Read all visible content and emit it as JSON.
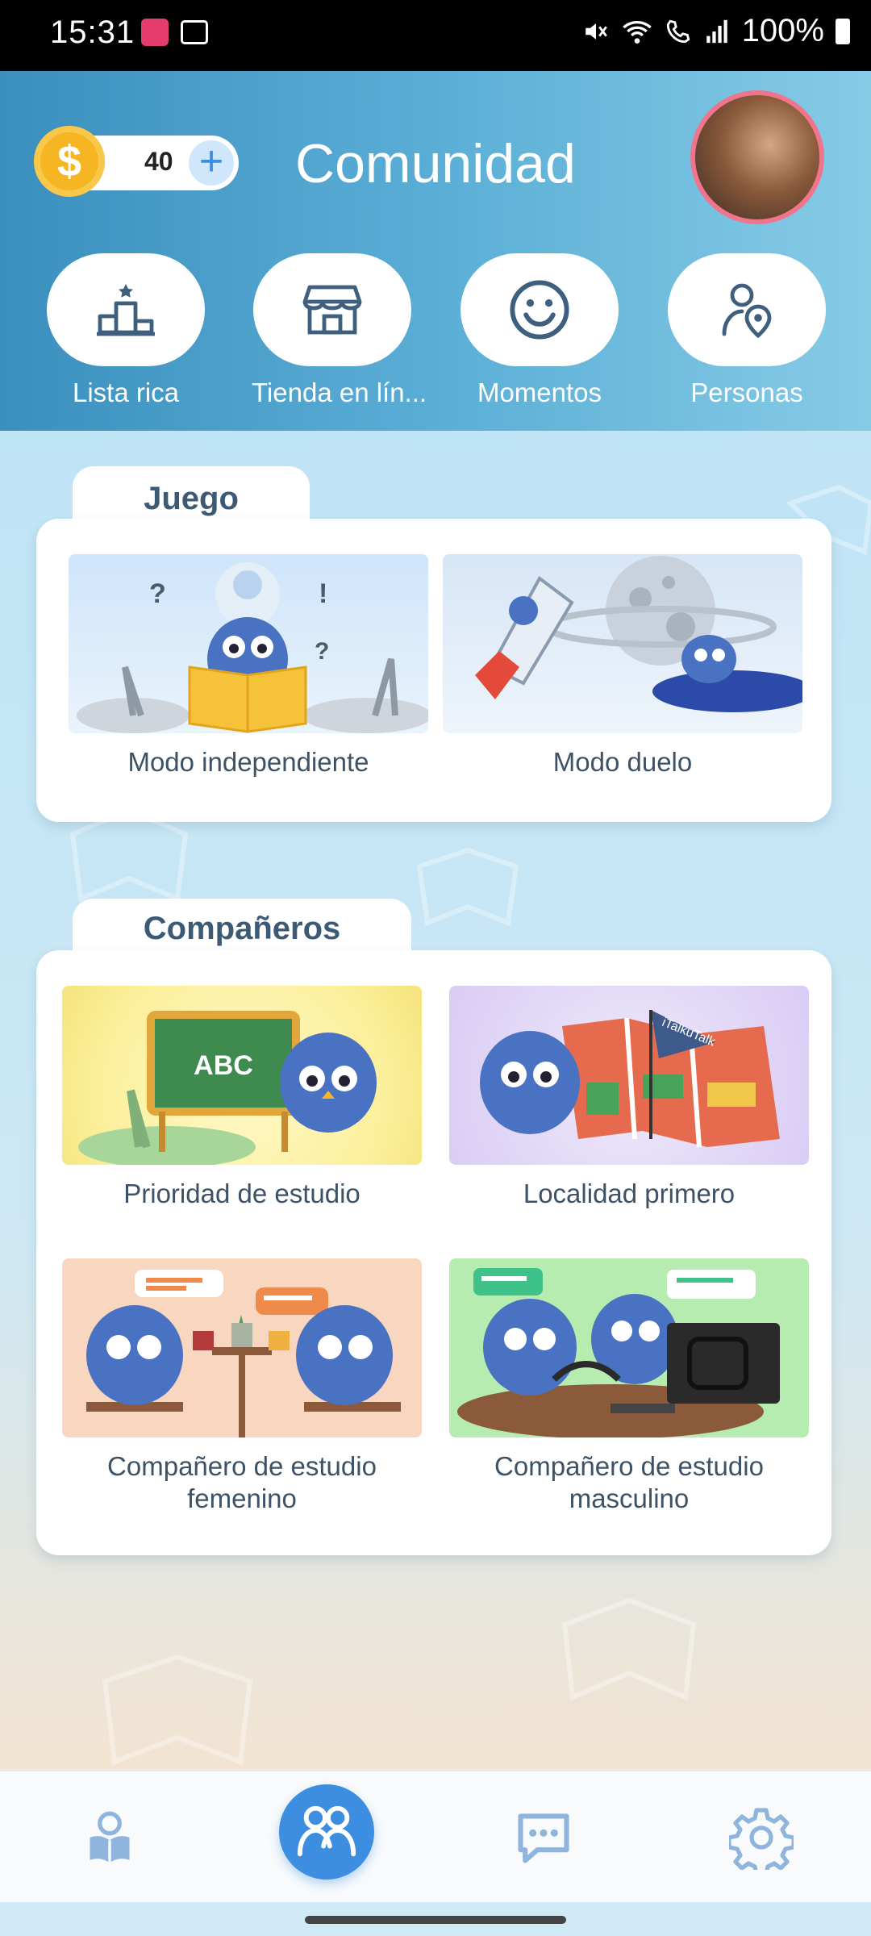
{
  "status_bar": {
    "time": "15:31",
    "battery": "100%"
  },
  "header": {
    "coins": "40",
    "add_symbol": "+",
    "coin_symbol": "$",
    "title": "Comunidad",
    "quick_actions": [
      {
        "label": "Lista rica",
        "icon": "podium-icon"
      },
      {
        "label": "Tienda en lín...",
        "icon": "store-icon"
      },
      {
        "label": "Momentos",
        "icon": "smiley-icon"
      },
      {
        "label": "Personas",
        "icon": "person-location-icon"
      }
    ]
  },
  "game_section": {
    "title": "Juego",
    "modes": [
      {
        "label": "Modo independiente"
      },
      {
        "label": "Modo duelo"
      }
    ]
  },
  "partners_section": {
    "title": "Compañeros",
    "options": [
      {
        "label": "Prioridad de estudio",
        "image_text": "ABC"
      },
      {
        "label": "Localidad primero",
        "image_text": "iTalkuTalk"
      },
      {
        "label": "Compañero de estudio femenino"
      },
      {
        "label": "Compañero de estudio masculino"
      }
    ]
  },
  "bottom_nav": [
    {
      "name": "learn",
      "icon": "person-book-icon",
      "active": false
    },
    {
      "name": "community",
      "icon": "people-icon",
      "active": true
    },
    {
      "name": "messages",
      "icon": "chat-icon",
      "active": false
    },
    {
      "name": "settings",
      "icon": "gear-icon",
      "active": false
    }
  ],
  "colors": {
    "accent": "#3d8ee0",
    "header_start": "#3b8fbd",
    "header_end": "#86cbe6",
    "coin": "#f6b623",
    "section_title": "#3d5a75"
  }
}
